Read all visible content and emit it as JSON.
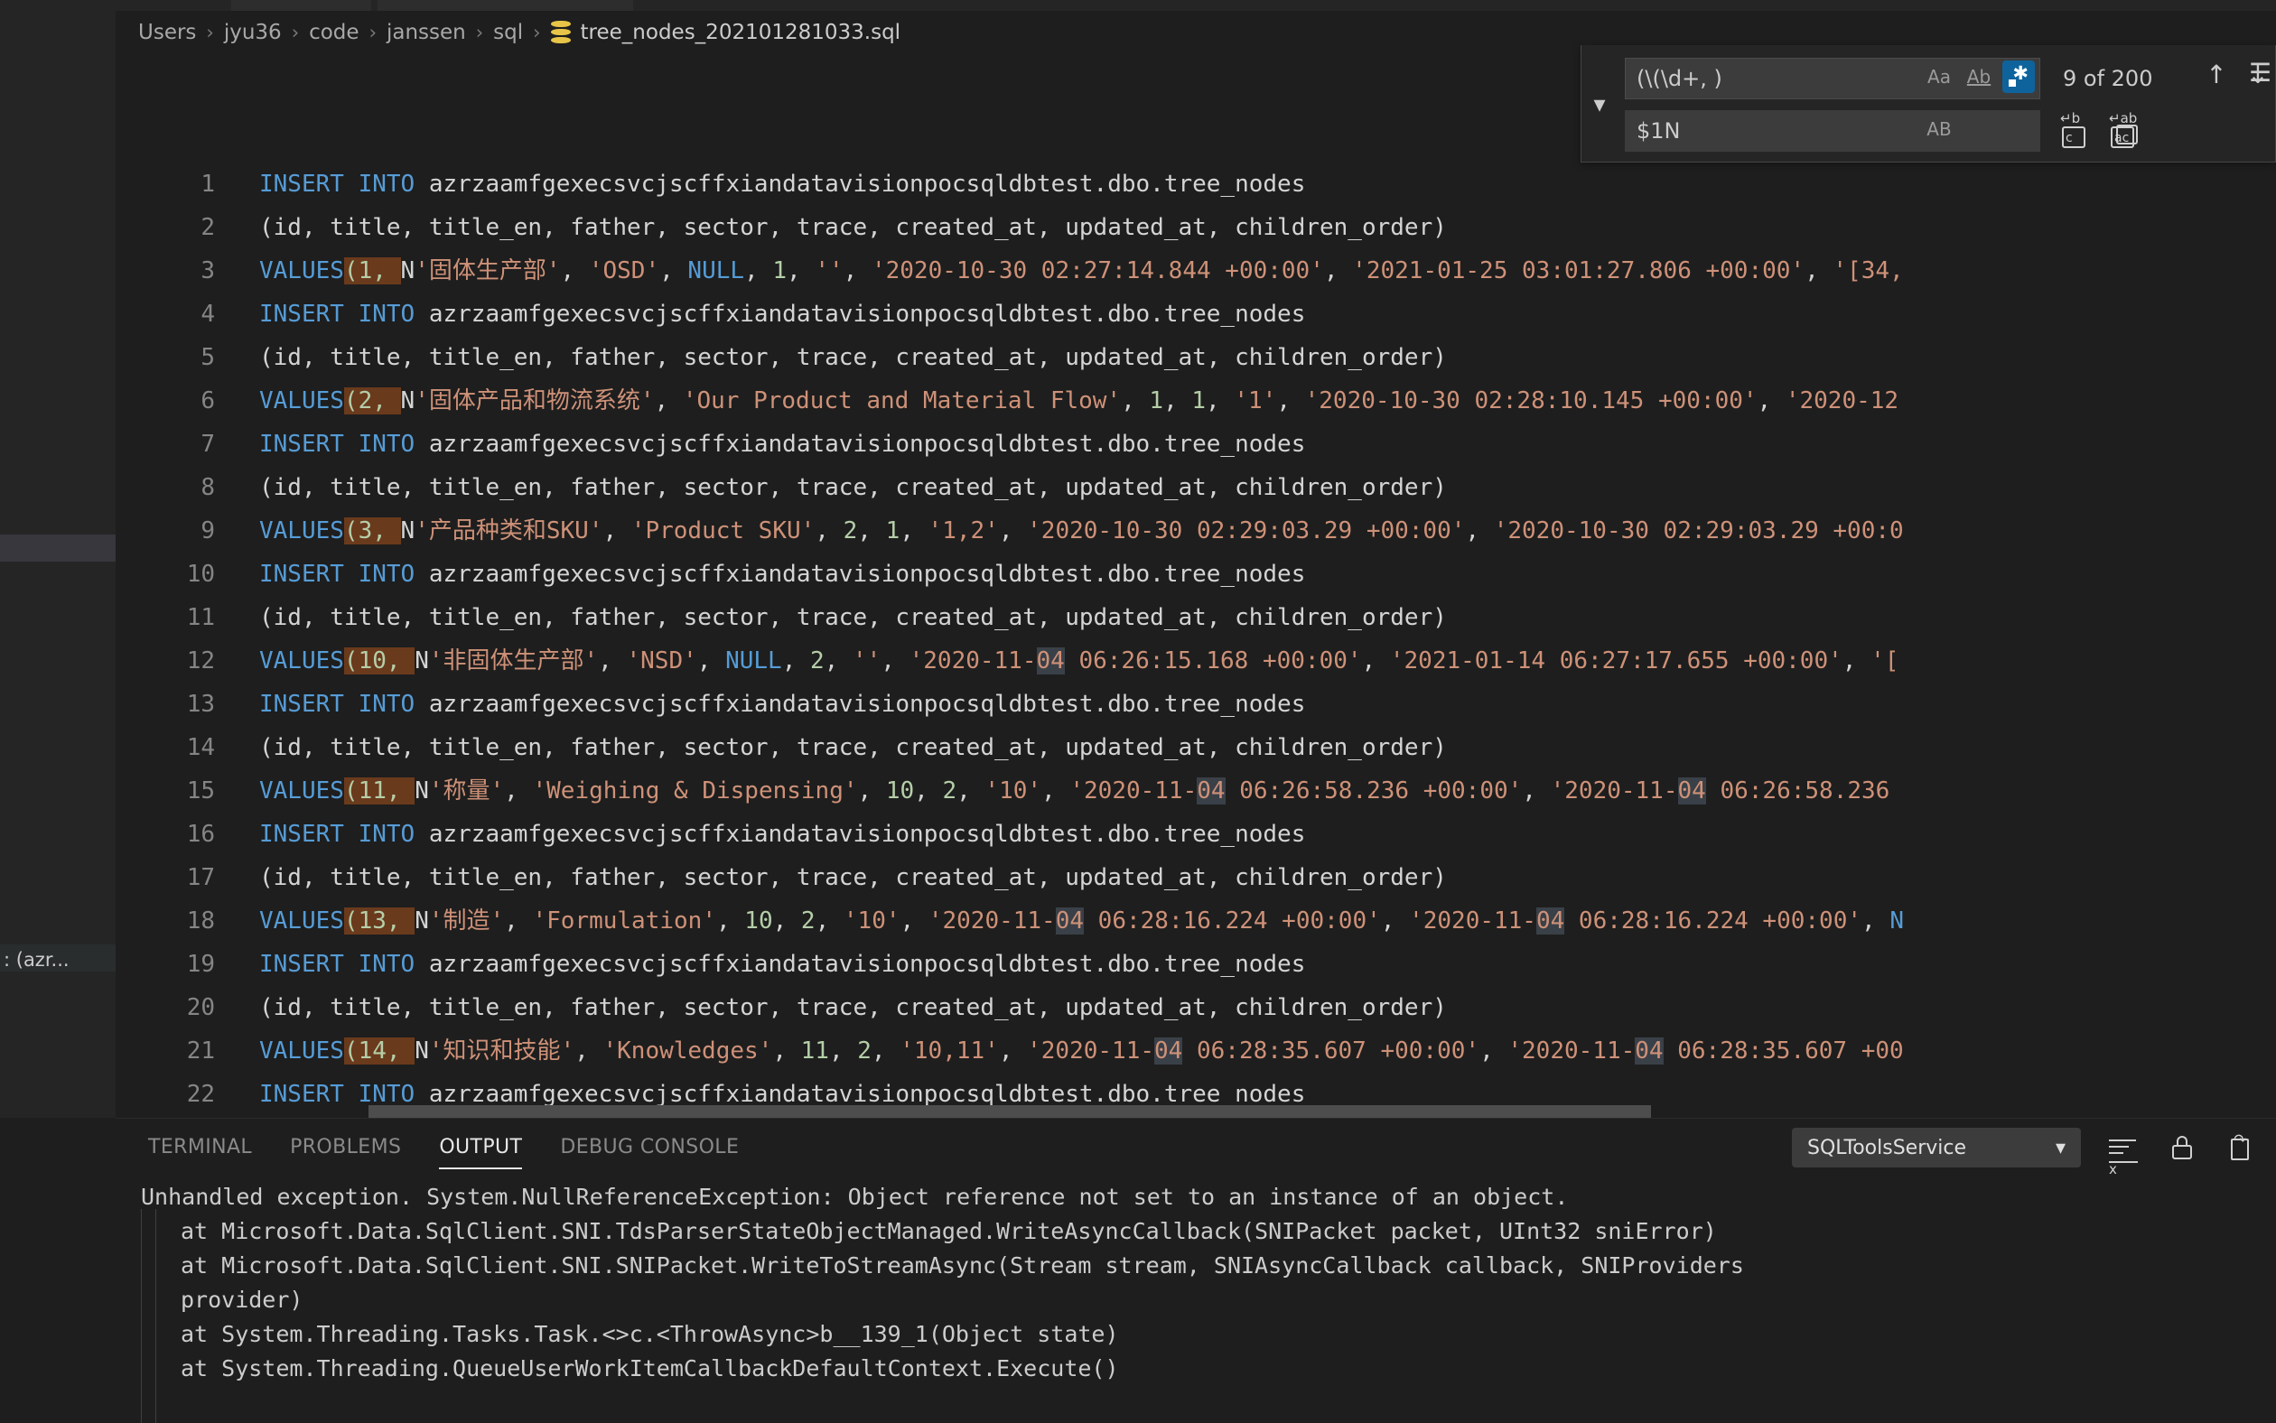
{
  "breadcrumb": {
    "items": [
      "Users",
      "jyu36",
      "code",
      "janssen",
      "sql"
    ],
    "separator": "›",
    "file": "tree_nodes_202101281033.sql"
  },
  "find_widget": {
    "toggle_icon": "chevron-down",
    "find_value": "(\\(\\d+, )",
    "replace_value": "$1N",
    "match_case_label": "Aa",
    "whole_word_label": "Ab",
    "regex_label": ".*",
    "preserve_case_label": "AB",
    "results": "9 of 200",
    "prev_icon": "↑",
    "next_icon": "↓",
    "menu_icon": "☰",
    "replace_one_icon": "replace-icon",
    "replace_all_icon": "replace-all-icon",
    "regex_active": true,
    "accent": "#0e639c"
  },
  "editor": {
    "first_line": 1,
    "lines": [
      {
        "n": "1",
        "tokens": [
          {
            "t": "INSERT INTO",
            "c": "kw"
          },
          {
            "t": " azrzaamfgexecsvcjscffxiandatavisionpocsqldbtest.dbo.tree_nodes",
            "c": "plain"
          }
        ]
      },
      {
        "n": "2",
        "tokens": [
          {
            "t": "(id, title, title_en, father, sector, trace, created_at, updated_at, children_order)",
            "c": "plain"
          }
        ]
      },
      {
        "n": "3",
        "tokens": [
          {
            "t": "VALUES",
            "c": "kw"
          },
          {
            "t": "(1, ",
            "c": "num",
            "m": "cur"
          },
          {
            "t": "N",
            "c": "plain"
          },
          {
            "t": "'固体生产部'",
            "c": "str"
          },
          {
            "t": ", ",
            "c": "plain"
          },
          {
            "t": "'OSD'",
            "c": "str"
          },
          {
            "t": ", ",
            "c": "plain"
          },
          {
            "t": "NULL",
            "c": "kw"
          },
          {
            "t": ", ",
            "c": "plain"
          },
          {
            "t": "1",
            "c": "num"
          },
          {
            "t": ", ",
            "c": "plain"
          },
          {
            "t": "''",
            "c": "str"
          },
          {
            "t": ", ",
            "c": "plain"
          },
          {
            "t": "'2020-10-30 02:27:14.844 +00:00'",
            "c": "str"
          },
          {
            "t": ", ",
            "c": "plain"
          },
          {
            "t": "'2021-01-25 03:01:27.806 +00:00'",
            "c": "str"
          },
          {
            "t": ", ",
            "c": "plain"
          },
          {
            "t": "'[34,",
            "c": "str"
          }
        ]
      },
      {
        "n": "4",
        "tokens": [
          {
            "t": "INSERT INTO",
            "c": "kw"
          },
          {
            "t": " azrzaamfgexecsvcjscffxiandatavisionpocsqldbtest.dbo.tree_nodes",
            "c": "plain"
          }
        ]
      },
      {
        "n": "5",
        "tokens": [
          {
            "t": "(id, title, title_en, father, sector, trace, created_at, updated_at, children_order)",
            "c": "plain"
          }
        ]
      },
      {
        "n": "6",
        "tokens": [
          {
            "t": "VALUES",
            "c": "kw"
          },
          {
            "t": "(2, ",
            "c": "num",
            "m": "cur"
          },
          {
            "t": "N",
            "c": "plain"
          },
          {
            "t": "'固体产品和物流系统'",
            "c": "str"
          },
          {
            "t": ", ",
            "c": "plain"
          },
          {
            "t": "'Our Product and Material Flow'",
            "c": "str"
          },
          {
            "t": ", ",
            "c": "plain"
          },
          {
            "t": "1",
            "c": "num"
          },
          {
            "t": ", ",
            "c": "plain"
          },
          {
            "t": "1",
            "c": "num"
          },
          {
            "t": ", ",
            "c": "plain"
          },
          {
            "t": "'1'",
            "c": "str"
          },
          {
            "t": ", ",
            "c": "plain"
          },
          {
            "t": "'2020-10-30 02:28:10.145 +00:00'",
            "c": "str"
          },
          {
            "t": ", ",
            "c": "plain"
          },
          {
            "t": "'2020-12",
            "c": "str"
          }
        ]
      },
      {
        "n": "7",
        "tokens": [
          {
            "t": "INSERT INTO",
            "c": "kw"
          },
          {
            "t": " azrzaamfgexecsvcjscffxiandatavisionpocsqldbtest.dbo.tree_nodes",
            "c": "plain"
          }
        ]
      },
      {
        "n": "8",
        "tokens": [
          {
            "t": "(id, title, title_en, father, sector, trace, created_at, updated_at, children_order)",
            "c": "plain"
          }
        ]
      },
      {
        "n": "9",
        "tokens": [
          {
            "t": "VALUES",
            "c": "kw"
          },
          {
            "t": "(3, ",
            "c": "num",
            "m": "cur"
          },
          {
            "t": "N",
            "c": "plain"
          },
          {
            "t": "'产品种类和SKU'",
            "c": "str"
          },
          {
            "t": ", ",
            "c": "plain"
          },
          {
            "t": "'Product SKU'",
            "c": "str"
          },
          {
            "t": ", ",
            "c": "plain"
          },
          {
            "t": "2",
            "c": "num"
          },
          {
            "t": ", ",
            "c": "plain"
          },
          {
            "t": "1",
            "c": "num"
          },
          {
            "t": ", ",
            "c": "plain"
          },
          {
            "t": "'1,2'",
            "c": "str"
          },
          {
            "t": ", ",
            "c": "plain"
          },
          {
            "t": "'2020-10-30 02:29:03.29 +00:00'",
            "c": "str"
          },
          {
            "t": ", ",
            "c": "plain"
          },
          {
            "t": "'2020-10-30 02:29:03.29 +00:0",
            "c": "str"
          }
        ]
      },
      {
        "n": "10",
        "tokens": [
          {
            "t": "INSERT INTO",
            "c": "kw"
          },
          {
            "t": " azrzaamfgexecsvcjscffxiandatavisionpocsqldbtest.dbo.tree_nodes",
            "c": "plain"
          }
        ]
      },
      {
        "n": "11",
        "tokens": [
          {
            "t": "(id, title, title_en, father, sector, trace, created_at, updated_at, children_order)",
            "c": "plain"
          }
        ]
      },
      {
        "n": "12",
        "tokens": [
          {
            "t": "VALUES",
            "c": "kw"
          },
          {
            "t": "(10, ",
            "c": "num",
            "m": "cur"
          },
          {
            "t": "N",
            "c": "plain"
          },
          {
            "t": "'非固体生产部'",
            "c": "str"
          },
          {
            "t": ", ",
            "c": "plain"
          },
          {
            "t": "'NSD'",
            "c": "str"
          },
          {
            "t": ", ",
            "c": "plain"
          },
          {
            "t": "NULL",
            "c": "kw"
          },
          {
            "t": ", ",
            "c": "plain"
          },
          {
            "t": "2",
            "c": "num"
          },
          {
            "t": ", ",
            "c": "plain"
          },
          {
            "t": "''",
            "c": "str"
          },
          {
            "t": ", ",
            "c": "plain"
          },
          {
            "t": "'2020-11-",
            "c": "str"
          },
          {
            "t": "04",
            "c": "str",
            "m": "other"
          },
          {
            "t": " 06:26:15.168 +00:00'",
            "c": "str"
          },
          {
            "t": ", ",
            "c": "plain"
          },
          {
            "t": "'2021-01-14 06:27:17.655 +00:00'",
            "c": "str"
          },
          {
            "t": ", ",
            "c": "plain"
          },
          {
            "t": "'[",
            "c": "str"
          }
        ]
      },
      {
        "n": "13",
        "tokens": [
          {
            "t": "INSERT INTO",
            "c": "kw"
          },
          {
            "t": " azrzaamfgexecsvcjscffxiandatavisionpocsqldbtest.dbo.tree_nodes",
            "c": "plain"
          }
        ]
      },
      {
        "n": "14",
        "tokens": [
          {
            "t": "(id, title, title_en, father, sector, trace, created_at, updated_at, children_order)",
            "c": "plain"
          }
        ]
      },
      {
        "n": "15",
        "tokens": [
          {
            "t": "VALUES",
            "c": "kw"
          },
          {
            "t": "(11, ",
            "c": "num",
            "m": "cur"
          },
          {
            "t": "N",
            "c": "plain"
          },
          {
            "t": "'称量'",
            "c": "str"
          },
          {
            "t": ", ",
            "c": "plain"
          },
          {
            "t": "'Weighing & Dispensing'",
            "c": "str"
          },
          {
            "t": ", ",
            "c": "plain"
          },
          {
            "t": "10",
            "c": "num"
          },
          {
            "t": ", ",
            "c": "plain"
          },
          {
            "t": "2",
            "c": "num"
          },
          {
            "t": ", ",
            "c": "plain"
          },
          {
            "t": "'10'",
            "c": "str"
          },
          {
            "t": ", ",
            "c": "plain"
          },
          {
            "t": "'2020-11-",
            "c": "str"
          },
          {
            "t": "04",
            "c": "str",
            "m": "other"
          },
          {
            "t": " 06:26:58.236 +00:00'",
            "c": "str"
          },
          {
            "t": ", ",
            "c": "plain"
          },
          {
            "t": "'2020-11-",
            "c": "str"
          },
          {
            "t": "04",
            "c": "str",
            "m": "other"
          },
          {
            "t": " 06:26:58.236 ",
            "c": "str"
          }
        ]
      },
      {
        "n": "16",
        "tokens": [
          {
            "t": "INSERT INTO",
            "c": "kw"
          },
          {
            "t": " azrzaamfgexecsvcjscffxiandatavisionpocsqldbtest.dbo.tree_nodes",
            "c": "plain"
          }
        ]
      },
      {
        "n": "17",
        "tokens": [
          {
            "t": "(id, title, title_en, father, sector, trace, created_at, updated_at, children_order)",
            "c": "plain"
          }
        ]
      },
      {
        "n": "18",
        "tokens": [
          {
            "t": "VALUES",
            "c": "kw"
          },
          {
            "t": "(13, ",
            "c": "num",
            "m": "cur"
          },
          {
            "t": "N",
            "c": "plain"
          },
          {
            "t": "'制造'",
            "c": "str"
          },
          {
            "t": ", ",
            "c": "plain"
          },
          {
            "t": "'Formulation'",
            "c": "str"
          },
          {
            "t": ", ",
            "c": "plain"
          },
          {
            "t": "10",
            "c": "num"
          },
          {
            "t": ", ",
            "c": "plain"
          },
          {
            "t": "2",
            "c": "num"
          },
          {
            "t": ", ",
            "c": "plain"
          },
          {
            "t": "'10'",
            "c": "str"
          },
          {
            "t": ", ",
            "c": "plain"
          },
          {
            "t": "'2020-11-",
            "c": "str"
          },
          {
            "t": "04",
            "c": "str",
            "m": "other"
          },
          {
            "t": " 06:28:16.224 +00:00'",
            "c": "str"
          },
          {
            "t": ", ",
            "c": "plain"
          },
          {
            "t": "'2020-11-",
            "c": "str"
          },
          {
            "t": "04",
            "c": "str",
            "m": "other"
          },
          {
            "t": " 06:28:16.224 +00:00'",
            "c": "str"
          },
          {
            "t": ", ",
            "c": "plain"
          },
          {
            "t": "N",
            "c": "kw"
          }
        ]
      },
      {
        "n": "19",
        "tokens": [
          {
            "t": "INSERT INTO",
            "c": "kw"
          },
          {
            "t": " azrzaamfgexecsvcjscffxiandatavisionpocsqldbtest.dbo.tree_nodes",
            "c": "plain"
          }
        ]
      },
      {
        "n": "20",
        "tokens": [
          {
            "t": "(id, title, title_en, father, sector, trace, created_at, updated_at, children_order)",
            "c": "plain"
          }
        ]
      },
      {
        "n": "21",
        "tokens": [
          {
            "t": "VALUES",
            "c": "kw"
          },
          {
            "t": "(14, ",
            "c": "num",
            "m": "cur"
          },
          {
            "t": "N",
            "c": "plain"
          },
          {
            "t": "'知识和技能'",
            "c": "str"
          },
          {
            "t": ", ",
            "c": "plain"
          },
          {
            "t": "'Knowledges'",
            "c": "str"
          },
          {
            "t": ", ",
            "c": "plain"
          },
          {
            "t": "11",
            "c": "num"
          },
          {
            "t": ", ",
            "c": "plain"
          },
          {
            "t": "2",
            "c": "num"
          },
          {
            "t": ", ",
            "c": "plain"
          },
          {
            "t": "'10,11'",
            "c": "str"
          },
          {
            "t": ", ",
            "c": "plain"
          },
          {
            "t": "'2020-11-",
            "c": "str"
          },
          {
            "t": "04",
            "c": "str",
            "m": "other"
          },
          {
            "t": " 06:28:35.607 +00:00'",
            "c": "str"
          },
          {
            "t": ", ",
            "c": "plain"
          },
          {
            "t": "'2020-11-",
            "c": "str"
          },
          {
            "t": "04",
            "c": "str",
            "m": "other"
          },
          {
            "t": " 06:28:35.607 +00",
            "c": "str"
          }
        ]
      },
      {
        "n": "22",
        "tokens": [
          {
            "t": "INSERT INTO",
            "c": "kw"
          },
          {
            "t": " azrzaamfgexecsvcjscffxiandatavisionpocsqldbtest.dbo.tree_nodes",
            "c": "plain"
          }
        ]
      }
    ]
  },
  "sidebar": {
    "ghost_label": ": (azr..."
  },
  "panel": {
    "tabs": [
      {
        "label": "TERMINAL",
        "active": false
      },
      {
        "label": "PROBLEMS",
        "active": false
      },
      {
        "label": "OUTPUT",
        "active": true
      },
      {
        "label": "DEBUG CONSOLE",
        "active": false
      }
    ],
    "channel": "SQLToolsService",
    "chevron": "⌄",
    "actions": [
      "clear-output-icon",
      "lock-scroll-icon",
      "open-in-editor-icon"
    ],
    "output_lines": [
      {
        "text": "Unhandled exception. System.NullReferenceException: Object reference not set to an instance of an object.",
        "indent": false
      },
      {
        "text": "at Microsoft.Data.SqlClient.SNI.TdsParserStateObjectManaged.WriteAsyncCallback(SNIPacket packet, UInt32 sniError)",
        "indent": true
      },
      {
        "text": "at Microsoft.Data.SqlClient.SNI.SNIPacket.WriteToStreamAsync(Stream stream, SNIAsyncCallback callback, SNIProviders",
        "indent": true
      },
      {
        "text": "provider)",
        "indent": true
      },
      {
        "text": "at System.Threading.Tasks.Task.<>c.<ThrowAsync>b__139_1(Object state)",
        "indent": true
      },
      {
        "text": "at System.Threading.QueueUserWorkItemCallbackDefaultContext.Execute()",
        "indent": true
      }
    ]
  },
  "colors": {
    "background": "#1e1e1e",
    "sidebar": "#252526",
    "keyword": "#569cd6",
    "string": "#ce9178",
    "number": "#b5cea8",
    "text": "#d4d4d4",
    "current_match": "#6a3a1c",
    "other_match": "#3a4048",
    "accent": "#0e639c"
  }
}
